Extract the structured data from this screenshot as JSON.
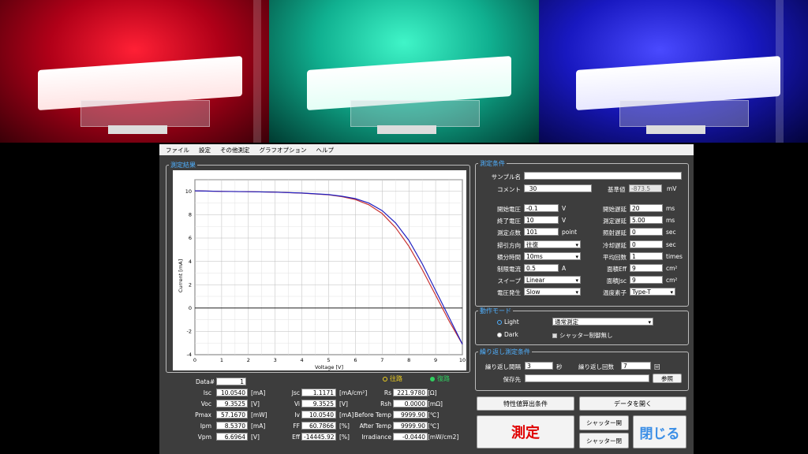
{
  "menu": [
    "ファイル",
    "設定",
    "その他測定",
    "グラフオプション",
    "ヘルプ"
  ],
  "results_title": "測定結果",
  "chart_data": {
    "type": "line",
    "xlabel": "Voltage [V]",
    "ylabel": "Current [mA]",
    "xlim": [
      0,
      10
    ],
    "ylim": [
      -4,
      11
    ],
    "x_ticks": [
      "0",
      "1",
      "2",
      "3",
      "4",
      "5",
      "6",
      "7",
      "8",
      "9",
      "10"
    ],
    "y_ticks": [
      "10",
      "8",
      "6",
      "4",
      "2",
      "0",
      "-2",
      "-4"
    ],
    "series": [
      {
        "name": "往路",
        "color": "#c83232",
        "x": [
          0,
          1,
          2,
          3,
          4,
          5,
          5.5,
          6,
          6.5,
          7,
          7.5,
          8,
          8.5,
          9,
          9.5,
          10
        ],
        "values": [
          10.05,
          10.0,
          9.97,
          9.93,
          9.85,
          9.7,
          9.55,
          9.3,
          8.85,
          8.1,
          6.9,
          5.3,
          3.3,
          1.1,
          -1.1,
          -3.1
        ]
      },
      {
        "name": "復路",
        "color": "#2020c0",
        "x": [
          0,
          1,
          2,
          3,
          4,
          5,
          5.5,
          6,
          6.5,
          7,
          7.5,
          8,
          8.5,
          9,
          9.5,
          10
        ],
        "values": [
          10.05,
          10.0,
          9.97,
          9.93,
          9.86,
          9.72,
          9.58,
          9.38,
          9.0,
          8.35,
          7.3,
          5.8,
          3.8,
          1.5,
          -0.8,
          -3.1
        ]
      }
    ],
    "grid": true
  },
  "legend": {
    "forward": "往路",
    "backward": "復路"
  },
  "data_label": "Data#",
  "data_num": "1",
  "results": [
    {
      "label": "Isc",
      "value": "10.0540",
      "unit": "[mA]"
    },
    {
      "label": "Voc",
      "value": "9.3525",
      "unit": "[V]"
    },
    {
      "label": "Pmax",
      "value": "57.1670",
      "unit": "[mW]"
    },
    {
      "label": "Ipm",
      "value": "8.5370",
      "unit": "[mA]"
    },
    {
      "label": "Vpm",
      "value": "6.6964",
      "unit": "[V]"
    }
  ],
  "results2": [
    {
      "label": "Jsc",
      "value": "1.1171",
      "unit": "[mA/cm²]"
    },
    {
      "label": "Vi",
      "value": "9.3525",
      "unit": "[V]"
    },
    {
      "label": "Iv",
      "value": "10.0540",
      "unit": "[mA]"
    },
    {
      "label": "FF",
      "value": "60.7866",
      "unit": "[%]"
    },
    {
      "label": "Eff",
      "value": "-14445.92",
      "unit": "[%]"
    }
  ],
  "results3": [
    {
      "label": "Rs",
      "value": "221.9780",
      "unit": "[Ω]"
    },
    {
      "label": "Rsh",
      "value": "0.0000",
      "unit": "[mΩ]"
    },
    {
      "label": "Before Temp",
      "value": "9999.90",
      "unit": "[℃]"
    },
    {
      "label": "After Temp",
      "value": "9999.90",
      "unit": "[℃]"
    },
    {
      "label": "Irradiance",
      "value": "-0.0440",
      "unit": "[mW/cm2]"
    }
  ],
  "cond_title": "測定条件",
  "sample_label": "サンプル名",
  "sample_value": "",
  "comment_label": "コメント",
  "comment_value": "_30",
  "ref_label": "基準値",
  "ref_value": "-873.5",
  "ref_unit": "mV",
  "left_params": [
    {
      "label": "開始電圧",
      "value": "-0.1",
      "unit": "V"
    },
    {
      "label": "終了電圧",
      "value": "10",
      "unit": "V"
    },
    {
      "label": "測定点数",
      "value": "101",
      "unit": "point"
    },
    {
      "label": "掃引方向",
      "value": "往復",
      "select": true
    },
    {
      "label": "積分時間",
      "value": "10ms",
      "select": true
    },
    {
      "label": "制限電流",
      "value": "0.5",
      "unit": "A"
    },
    {
      "label": "スイープ",
      "value": "Linear",
      "select": true
    },
    {
      "label": "電圧発生",
      "value": "Slow",
      "select": true
    }
  ],
  "right_params": [
    {
      "label": "開始遅延",
      "value": "20",
      "unit": "ms"
    },
    {
      "label": "測定遅延",
      "value": "5.00",
      "unit": "ms"
    },
    {
      "label": "照射遅延",
      "value": "0",
      "unit": "sec"
    },
    {
      "label": "冷却遅延",
      "value": "0",
      "unit": "sec"
    },
    {
      "label": "平均回数",
      "value": "1",
      "unit": "times"
    },
    {
      "label": "面積Eff",
      "value": "9",
      "unit": "cm²"
    },
    {
      "label": "面積Jsc",
      "value": "9",
      "unit": "cm²"
    },
    {
      "label": "温度素子",
      "value": "Type-T",
      "select": true
    }
  ],
  "mode_title": "動作モード",
  "mode_light": "Light",
  "mode_dark": "Dark",
  "mode_select": "通常測定",
  "shutter_check": "シャッター制御無し",
  "repeat_title": "繰り返し測定条件",
  "repeat_interval_label": "繰り返し間隔",
  "repeat_interval_value": "3",
  "repeat_interval_unit": "秒",
  "repeat_count_label": "繰り返し回数",
  "repeat_count_value": "7",
  "repeat_count_unit": "回",
  "save_label": "保存先",
  "save_value": "",
  "browse_button": "参照",
  "char_button": "特性値算出条件",
  "open_button": "データを開く",
  "measure_button": "測定",
  "shutter_open_button": "シャッター開",
  "shutter_close_button": "シャッター閉",
  "close_button": "閉じる",
  "colors": {
    "accent_blue": "#4fb0ff",
    "measure_red": "#e00000",
    "close_blue": "#3a8ee6",
    "forward_yellow": "#f0d020",
    "backward_green": "#30d060"
  }
}
